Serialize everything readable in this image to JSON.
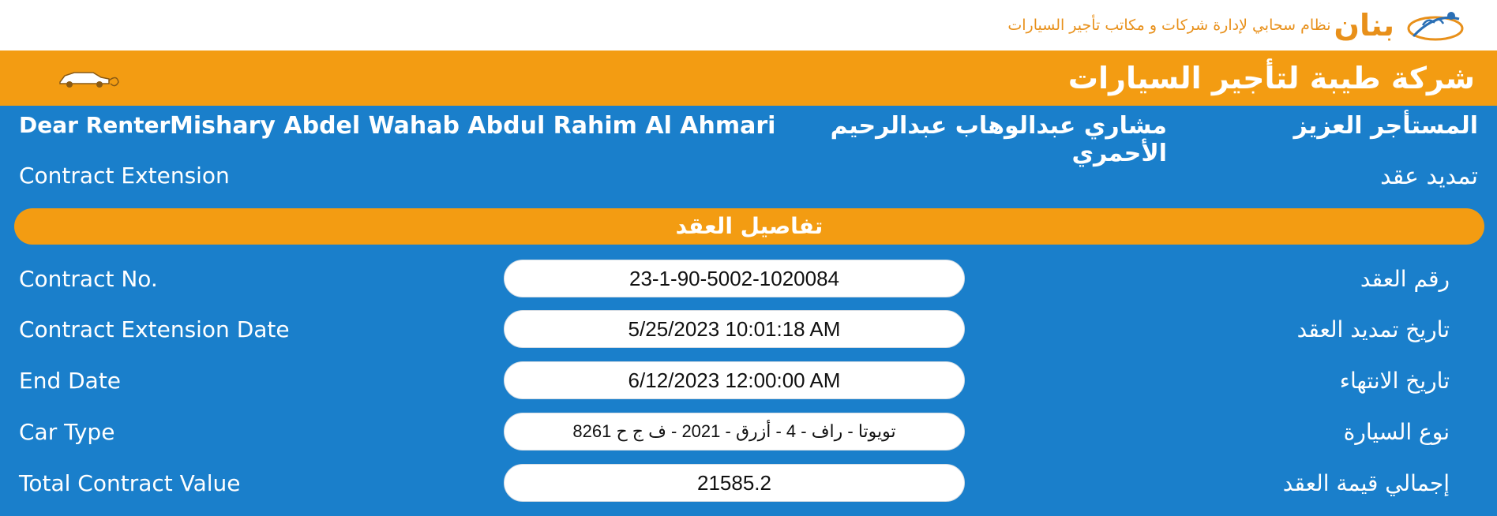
{
  "header": {
    "brand_name": "بنان",
    "brand_tagline": "نظام سحابي لإدارة شركات و مكاتب تأجير السيارات",
    "company_name": "شركة طيبة لتأجير السيارات",
    "icons": {
      "logo": "banan-logo",
      "car": "car-icon"
    }
  },
  "renter": {
    "label_en": "Dear Renter",
    "name_en": "Mishary Abdel Wahab Abdul Rahim Al Ahmari",
    "name_ar": "مشاري عبدالوهاب عبدالرحيم الأحمري",
    "label_ar": "المستأجر العزيز"
  },
  "page_title": {
    "en": "Contract Extension",
    "ar": "تمديد عقد"
  },
  "section_title": "تفاصيل العقد",
  "fields": [
    {
      "label_en": "Contract No.",
      "value": "23-1-90-5002-1020084",
      "label_ar": "رقم العقد"
    },
    {
      "label_en": "Contract Extension Date",
      "value": "5/25/2023 10:01:18 AM",
      "label_ar": "تاريخ تمديد العقد"
    },
    {
      "label_en": "End Date",
      "value": "6/12/2023 12:00:00 AM",
      "label_ar": "تاريخ الانتهاء"
    },
    {
      "label_en": "Car Type",
      "value": "تويوتا - راف - 4 - أزرق - 2021 - ف ج ح 8261",
      "label_ar": "نوع السيارة"
    },
    {
      "label_en": "Total Contract Value",
      "value": "21585.2",
      "label_ar": "إجمالي قيمة العقد"
    }
  ],
  "colors": {
    "orange": "#f39c12",
    "blue": "#1a7fcb",
    "brand_text": "#e8901a"
  }
}
